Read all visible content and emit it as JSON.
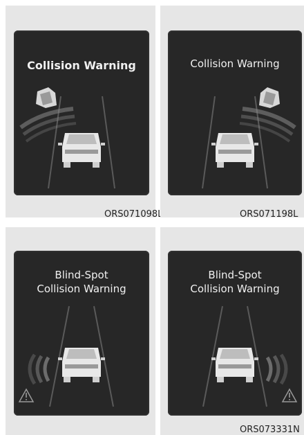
{
  "figures": [
    {
      "title_lines": [
        "Collision Warning"
      ],
      "code": "ORS071098L"
    },
    {
      "title_lines": [
        "Collision Warning"
      ],
      "code": "ORS071198L"
    },
    {
      "title_lines": [
        "Blind-Spot",
        "Collision Warning"
      ],
      "code": ""
    },
    {
      "title_lines": [
        "Blind-Spot",
        "Collision Warning"
      ],
      "code": "ORS073331N"
    }
  ],
  "colors": {
    "panel": "#e6e6e6",
    "screen": "#272727",
    "text": "#f0f0f0"
  },
  "icons": [
    "car-icon",
    "approaching-vehicle-icon",
    "warning-triangle-icon",
    "radar-waves-icon"
  ]
}
